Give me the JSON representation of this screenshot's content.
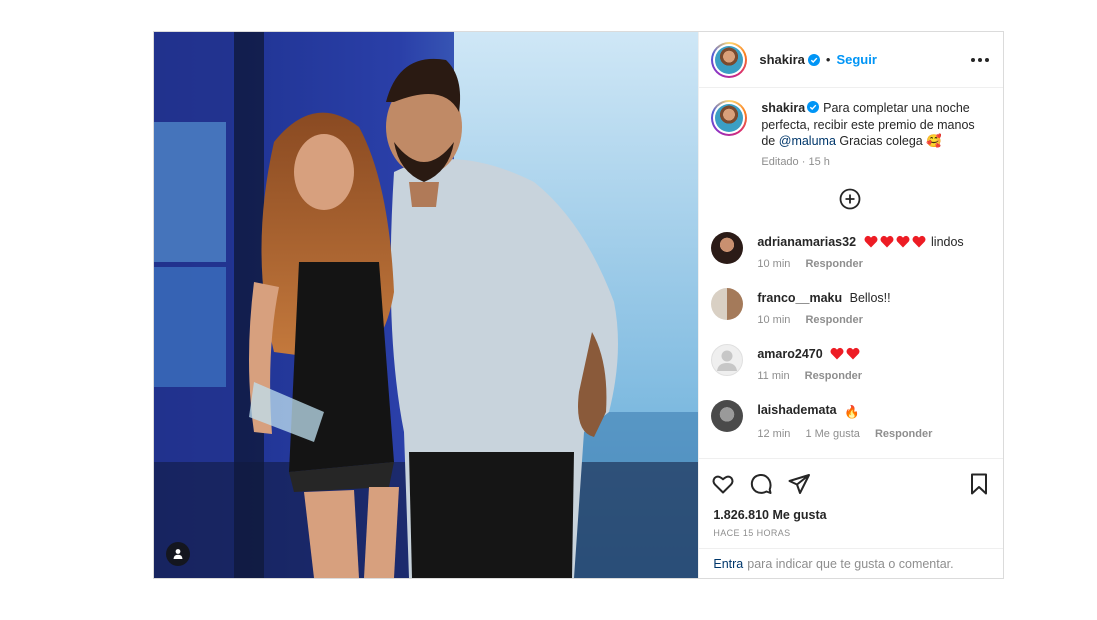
{
  "post": {
    "author": {
      "username": "shakira",
      "verified": true,
      "follow_label": "Seguir",
      "separator": "•"
    },
    "caption": {
      "username": "shakira",
      "text_before": "Para completar una noche perfecta, recibir este premio de manos de ",
      "mention": "@maluma",
      "text_after": " Gracias colega",
      "emoji": "🥰",
      "edited_label": "Editado",
      "separator": "·",
      "time": "15 h"
    },
    "comments": [
      {
        "username": "adrianamarias32",
        "text": "lindos",
        "hearts": 4,
        "time": "10 min",
        "reply_label": "Responder"
      },
      {
        "username": "franco__maku",
        "text": "Bellos!!",
        "hearts": 0,
        "time": "10 min",
        "reply_label": "Responder"
      },
      {
        "username": "amaro2470",
        "text": "",
        "hearts": 2,
        "time": "11 min",
        "reply_label": "Responder"
      },
      {
        "username": "laishademata",
        "text": "🔥",
        "hearts": 0,
        "time": "12 min",
        "likes_label": "1 Me gusta",
        "reply_label": "Responder"
      }
    ],
    "likes": "1.826.810 Me gusta",
    "posted_ago": "HACE 15 HORAS",
    "login_prompt": {
      "link": "Entra",
      "text": "para indicar que te gusta o comentar."
    },
    "icons": {
      "more": "more-options-icon",
      "load_more": "plus-circle-icon",
      "like": "heart-icon",
      "comment": "comment-icon",
      "share": "share-icon",
      "save": "bookmark-icon",
      "tagged_users": "user-tag-icon",
      "verified": "verified-badge-icon"
    },
    "colors": {
      "link_blue": "#0095f6",
      "mention_blue": "#00376b",
      "heart_red": "#ed1c24",
      "text_gray": "#8e8e8e"
    }
  }
}
